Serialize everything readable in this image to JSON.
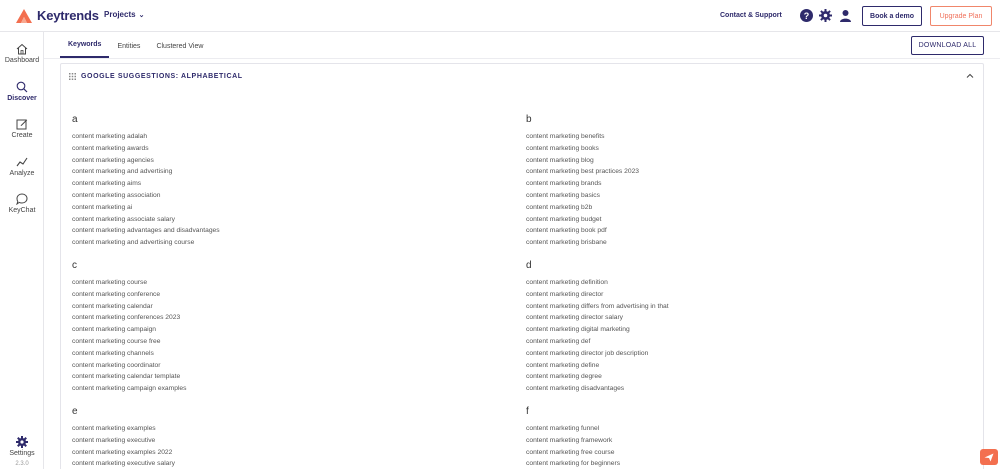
{
  "app": {
    "name": "Keytrends",
    "brand_color": "#2e2a6b",
    "accent_color": "#f36f4f"
  },
  "header": {
    "projects_label": "Projects",
    "contact_label": "Contact & Support",
    "icons": [
      "help-icon",
      "gear-icon",
      "user-icon"
    ],
    "book_demo_label": "Book a demo",
    "upgrade_label": "Upgrade Plan"
  },
  "sidebar": {
    "items": [
      {
        "label": "Dashboard",
        "icon": "home-icon"
      },
      {
        "label": "Discover",
        "icon": "search-icon"
      },
      {
        "label": "Create",
        "icon": "edit-icon"
      },
      {
        "label": "Analyze",
        "icon": "chart-icon"
      },
      {
        "label": "KeyChat",
        "icon": "chat-icon"
      }
    ],
    "settings_label": "Settings",
    "version": "2.3.0"
  },
  "tabs": [
    {
      "label": "Keywords",
      "active": true
    },
    {
      "label": "Entities",
      "active": false
    },
    {
      "label": "Clustered View",
      "active": false
    }
  ],
  "download_all_label": "DOWNLOAD ALL",
  "panel": {
    "title": "GOOGLE SUGGESTIONS: ALPHABETICAL",
    "groups": [
      {
        "letter": "a",
        "keywords": [
          "content marketing adalah",
          "content marketing awards",
          "content marketing agencies",
          "content marketing and advertising",
          "content marketing aims",
          "content marketing association",
          "content marketing ai",
          "content marketing associate salary",
          "content marketing advantages and disadvantages",
          "content marketing and advertising course"
        ]
      },
      {
        "letter": "b",
        "keywords": [
          "content marketing benefits",
          "content marketing books",
          "content marketing blog",
          "content marketing best practices 2023",
          "content marketing brands",
          "content marketing basics",
          "content marketing b2b",
          "content marketing budget",
          "content marketing book pdf",
          "content marketing brisbane"
        ]
      },
      {
        "letter": "c",
        "keywords": [
          "content marketing course",
          "content marketing conference",
          "content marketing calendar",
          "content marketing conferences 2023",
          "content marketing campaign",
          "content marketing course free",
          "content marketing channels",
          "content marketing coordinator",
          "content marketing calendar template",
          "content marketing campaign examples"
        ]
      },
      {
        "letter": "d",
        "keywords": [
          "content marketing definition",
          "content marketing director",
          "content marketing differs from advertising in that",
          "content marketing director salary",
          "content marketing digital marketing",
          "content marketing def",
          "content marketing director job description",
          "content marketing define",
          "content marketing degree",
          "content marketing disadvantages"
        ]
      },
      {
        "letter": "e",
        "keywords": [
          "content marketing examples",
          "content marketing executive",
          "content marketing examples 2022",
          "content marketing executive salary"
        ]
      },
      {
        "letter": "f",
        "keywords": [
          "content marketing funnel",
          "content marketing framework",
          "content marketing free course",
          "content marketing for beginners"
        ]
      }
    ]
  }
}
